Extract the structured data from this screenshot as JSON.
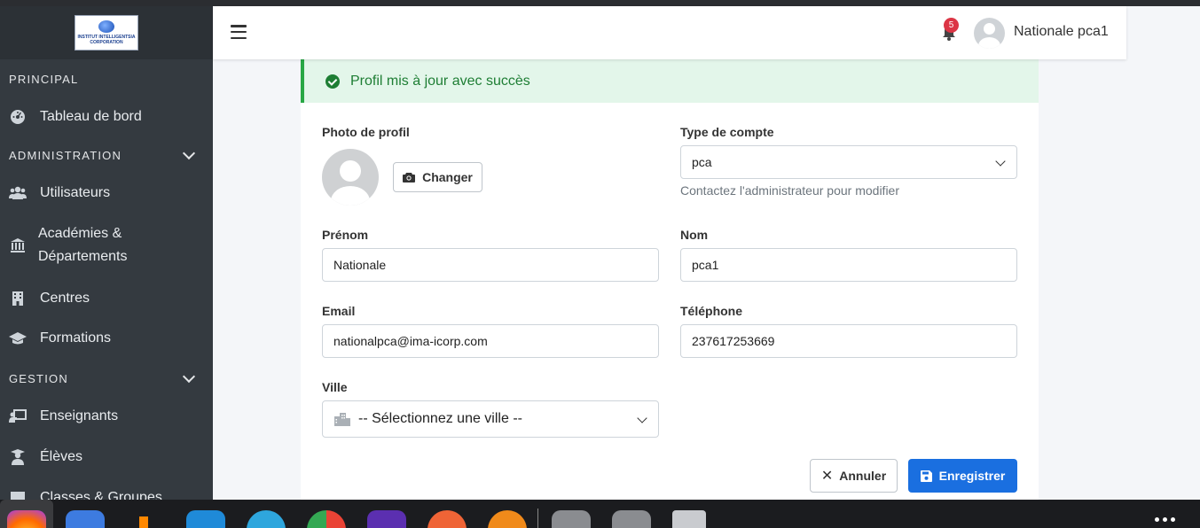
{
  "logo": {
    "text": "INSTITUT INTELLIGENTSIA CORPORATION"
  },
  "sidebar": {
    "sections": [
      {
        "label": "PRINCIPAL"
      },
      {
        "label": "ADMINISTRATION"
      },
      {
        "label": "GESTION"
      }
    ],
    "items": [
      {
        "label": "Tableau de bord",
        "icon": "dashboard-icon"
      },
      {
        "label": "Utilisateurs",
        "icon": "users-icon"
      },
      {
        "label": "Académies & Départements",
        "icon": "institution-icon"
      },
      {
        "label": "Centres",
        "icon": "building-icon"
      },
      {
        "label": "Formations",
        "icon": "graduation-cap-icon"
      },
      {
        "label": "Enseignants",
        "icon": "teacher-icon"
      },
      {
        "label": "Élèves",
        "icon": "student-icon"
      },
      {
        "label": "Classes & Groupes",
        "icon": "classes-icon"
      }
    ]
  },
  "header": {
    "notification_count": "5",
    "user_name": "Nationale pca1"
  },
  "alert": {
    "message": "Profil mis à jour avec succès"
  },
  "form": {
    "photo_label": "Photo de profil",
    "change_button": "Changer",
    "account_type_label": "Type de compte",
    "account_type_value": "pca",
    "account_type_help": "Contactez l'administrateur pour modifier",
    "first_name_label": "Prénom",
    "first_name_value": "Nationale",
    "last_name_label": "Nom",
    "last_name_value": "pca1",
    "email_label": "Email",
    "email_value": "nationalpca@ima-icorp.com",
    "phone_label": "Téléphone",
    "phone_value": "237617253669",
    "city_label": "Ville",
    "city_placeholder": "-- Sélectionnez une ville --",
    "cancel_button": "Annuler",
    "save_button": "Enregistrer"
  },
  "colors": {
    "sidebar_bg": "#343a40",
    "primary": "#1a6fe0",
    "success": "#28a745",
    "danger": "#dc3545"
  },
  "taskbar": {
    "apps": [
      "firefox-icon",
      "files-icon",
      "vlc-icon",
      "vscode-icon",
      "telegram-icon",
      "chrome-icon",
      "tor-icon",
      "git-icon",
      "blender-icon",
      "disk-icon",
      "disk-icon",
      "trash-icon"
    ]
  }
}
